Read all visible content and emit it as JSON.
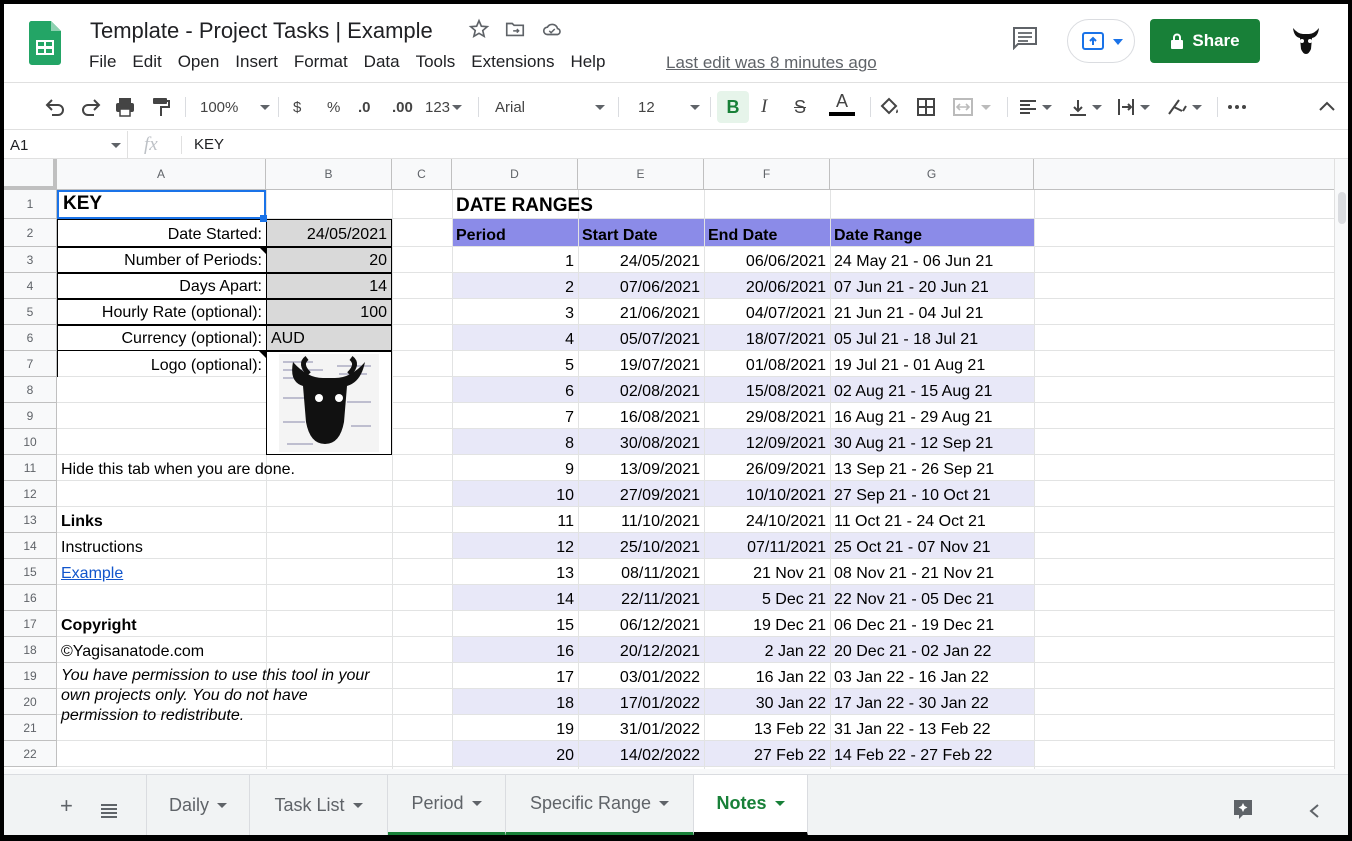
{
  "doc": {
    "title": "Template - Project Tasks | Example",
    "last_edit": "Last edit was 8 minutes ago",
    "share_label": "Share"
  },
  "menu": [
    "File",
    "Edit",
    "Open",
    "Insert",
    "Format",
    "Data",
    "Tools",
    "Extensions",
    "Help"
  ],
  "toolbar": {
    "zoom": "100%",
    "currency": "$",
    "percent": "%",
    "dec_less": ".0",
    "dec_more": ".00",
    "num_format": "123",
    "font": "Arial",
    "font_size": "12",
    "bold": "B",
    "italic": "I",
    "strike": "S",
    "text_color": "A"
  },
  "formula_bar": {
    "cell_ref": "A1",
    "fx": "fx",
    "value": "KEY"
  },
  "columns": [
    "A",
    "B",
    "C",
    "D",
    "E",
    "F",
    "G"
  ],
  "rows": [
    "1",
    "2",
    "3",
    "4",
    "5",
    "6",
    "7",
    "8",
    "9",
    "10",
    "11",
    "12",
    "13",
    "14",
    "15",
    "16",
    "17",
    "18",
    "19",
    "20",
    "21",
    "22"
  ],
  "key": {
    "title": "KEY",
    "date_started_label": "Date Started:",
    "date_started": "24/05/2021",
    "periods_label": "Number of Periods:",
    "periods": "20",
    "days_apart_label": "Days Apart:",
    "days_apart": "14",
    "hourly_label": "Hourly Rate (optional):",
    "hourly": "100",
    "currency_label": "Currency (optional):",
    "currency": "AUD",
    "logo_label": "Logo (optional):",
    "hide_note": "Hide this tab when you are done.",
    "links_heading": "Links",
    "instructions": "Instructions",
    "example": "Example",
    "copyright_heading": "Copyright",
    "copyright": "©Yagisanatode.com",
    "permission": "You have permission to use this tool in your own projects only. You do not have permission to redistribute."
  },
  "date_ranges": {
    "title": "DATE RANGES",
    "headers": [
      "Period",
      "Start Date",
      "End Date",
      "Date Range"
    ],
    "header_color": "#8b8be8",
    "band_color": "#e8e8f8",
    "rows": [
      [
        "1",
        "24/05/2021",
        "06/06/2021",
        "24 May 21 - 06 Jun 21"
      ],
      [
        "2",
        "07/06/2021",
        "20/06/2021",
        "07 Jun 21 - 20 Jun 21"
      ],
      [
        "3",
        "21/06/2021",
        "04/07/2021",
        "21 Jun 21 - 04 Jul 21"
      ],
      [
        "4",
        "05/07/2021",
        "18/07/2021",
        "05 Jul 21 - 18 Jul 21"
      ],
      [
        "5",
        "19/07/2021",
        "01/08/2021",
        "19 Jul 21 - 01 Aug 21"
      ],
      [
        "6",
        "02/08/2021",
        "15/08/2021",
        "02 Aug 21 - 15 Aug 21"
      ],
      [
        "7",
        "16/08/2021",
        "29/08/2021",
        "16 Aug 21 - 29 Aug 21"
      ],
      [
        "8",
        "30/08/2021",
        "12/09/2021",
        "30 Aug 21 - 12 Sep 21"
      ],
      [
        "9",
        "13/09/2021",
        "26/09/2021",
        "13 Sep 21 - 26 Sep 21"
      ],
      [
        "10",
        "27/09/2021",
        "10/10/2021",
        "27 Sep 21 - 10 Oct 21"
      ],
      [
        "11",
        "11/10/2021",
        "24/10/2021",
        "11 Oct 21 - 24 Oct 21"
      ],
      [
        "12",
        "25/10/2021",
        "07/11/2021",
        "25 Oct 21 - 07 Nov 21"
      ],
      [
        "13",
        "08/11/2021",
        "21 Nov 21",
        "08 Nov 21 - 21 Nov 21"
      ],
      [
        "14",
        "22/11/2021",
        "5 Dec 21",
        "22 Nov 21 - 05 Dec 21"
      ],
      [
        "15",
        "06/12/2021",
        "19 Dec 21",
        "06 Dec 21 - 19 Dec 21"
      ],
      [
        "16",
        "20/12/2021",
        "2 Jan 22",
        "20 Dec 21 - 02 Jan 22"
      ],
      [
        "17",
        "03/01/2022",
        "16 Jan 22",
        "03 Jan 22 - 16 Jan 22"
      ],
      [
        "18",
        "17/01/2022",
        "30 Jan 22",
        "17 Jan 22 - 30 Jan 22"
      ],
      [
        "19",
        "31/01/2022",
        "13 Feb 22",
        "31 Jan 22 - 13 Feb 22"
      ],
      [
        "20",
        "14/02/2022",
        "27 Feb 22",
        "14 Feb 22 - 27 Feb 22"
      ]
    ]
  },
  "sheets": [
    {
      "label": "Daily",
      "active": false
    },
    {
      "label": "Task List",
      "active": false
    },
    {
      "label": "Period",
      "active": false
    },
    {
      "label": "Specific Range",
      "active": false
    },
    {
      "label": "Notes",
      "active": true
    }
  ],
  "colors": {
    "share": "#188038",
    "active_tab": "#188038",
    "link": "#1155cc",
    "selection": "#1a73e8"
  }
}
